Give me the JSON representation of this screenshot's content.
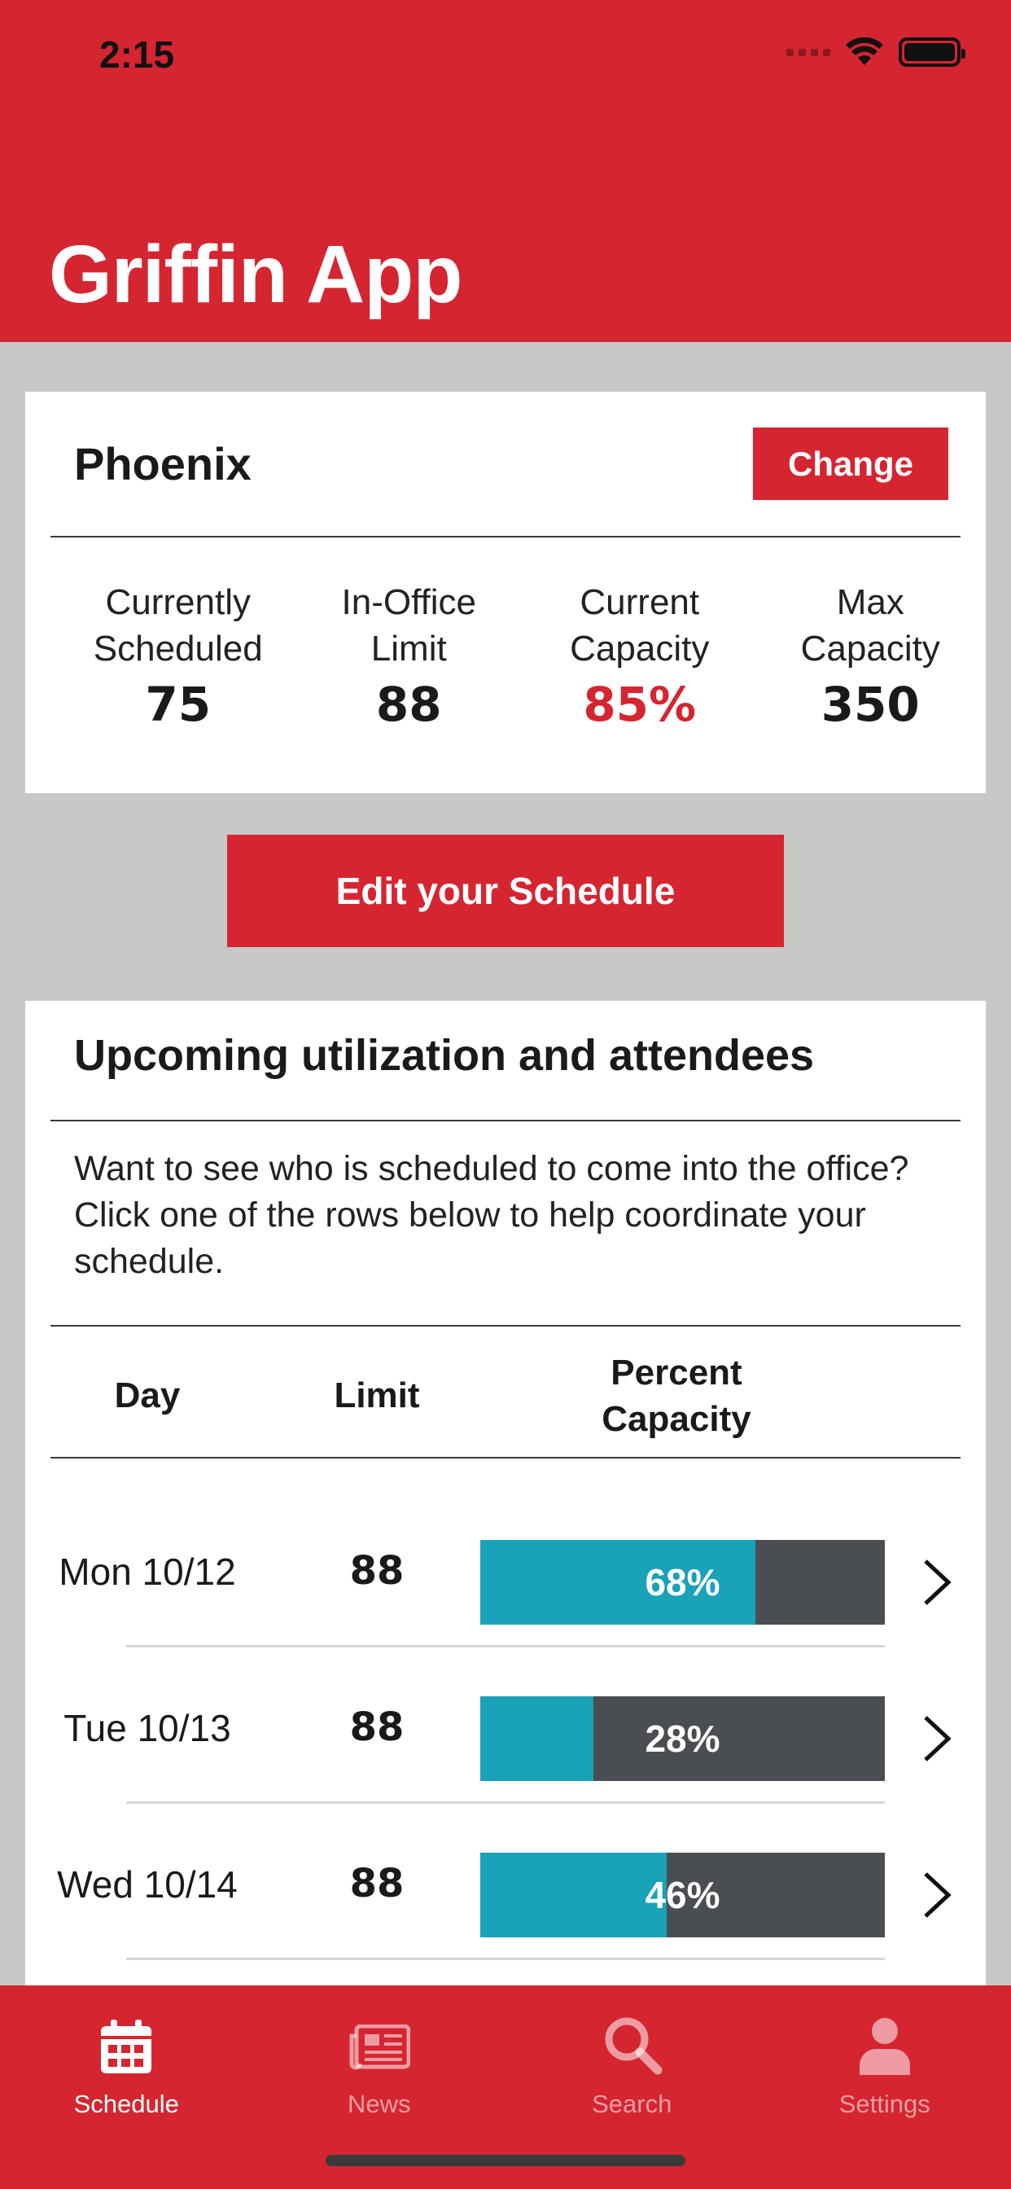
{
  "status_bar": {
    "time": "2:15"
  },
  "header": {
    "title": "Griffin App"
  },
  "location_card": {
    "name": "Phoenix",
    "change_label": "Change",
    "stats": [
      {
        "label_line1": "Currently",
        "label_line2": "Scheduled",
        "value": "75"
      },
      {
        "label_line1": "In-Office",
        "label_line2": "Limit",
        "value": "88"
      },
      {
        "label_line1": "Current",
        "label_line2": "Capacity",
        "value": "85%"
      },
      {
        "label_line1": "Max",
        "label_line2": "Capacity",
        "value": "350"
      }
    ]
  },
  "edit_schedule_label": "Edit your Schedule",
  "utilization": {
    "title": "Upcoming utilization and attendees",
    "description": "Want to see who is scheduled to come into the office? Click one of the rows below to help coordinate your schedule.",
    "columns": {
      "day": "Day",
      "limit": "Limit",
      "percent_line1": "Percent",
      "percent_line2": "Capacity"
    },
    "rows": [
      {
        "day": "Mon 10/12",
        "limit": "88",
        "percent": "68%",
        "fill": 0.68
      },
      {
        "day": "Tue 10/13",
        "limit": "88",
        "percent": "28%",
        "fill": 0.28
      },
      {
        "day": "Wed 10/14",
        "limit": "88",
        "percent": "46%",
        "fill": 0.46
      }
    ]
  },
  "tabbar": {
    "tabs": [
      {
        "label": "Schedule",
        "icon": "calendar-icon",
        "active": true
      },
      {
        "label": "News",
        "icon": "newspaper-icon",
        "active": false
      },
      {
        "label": "Search",
        "icon": "search-icon",
        "active": false
      },
      {
        "label": "Settings",
        "icon": "person-icon",
        "active": false
      }
    ]
  },
  "colors": {
    "brand": "#d52531",
    "bar_fill": "#19a2b8",
    "bar_track": "#4a4e52"
  }
}
